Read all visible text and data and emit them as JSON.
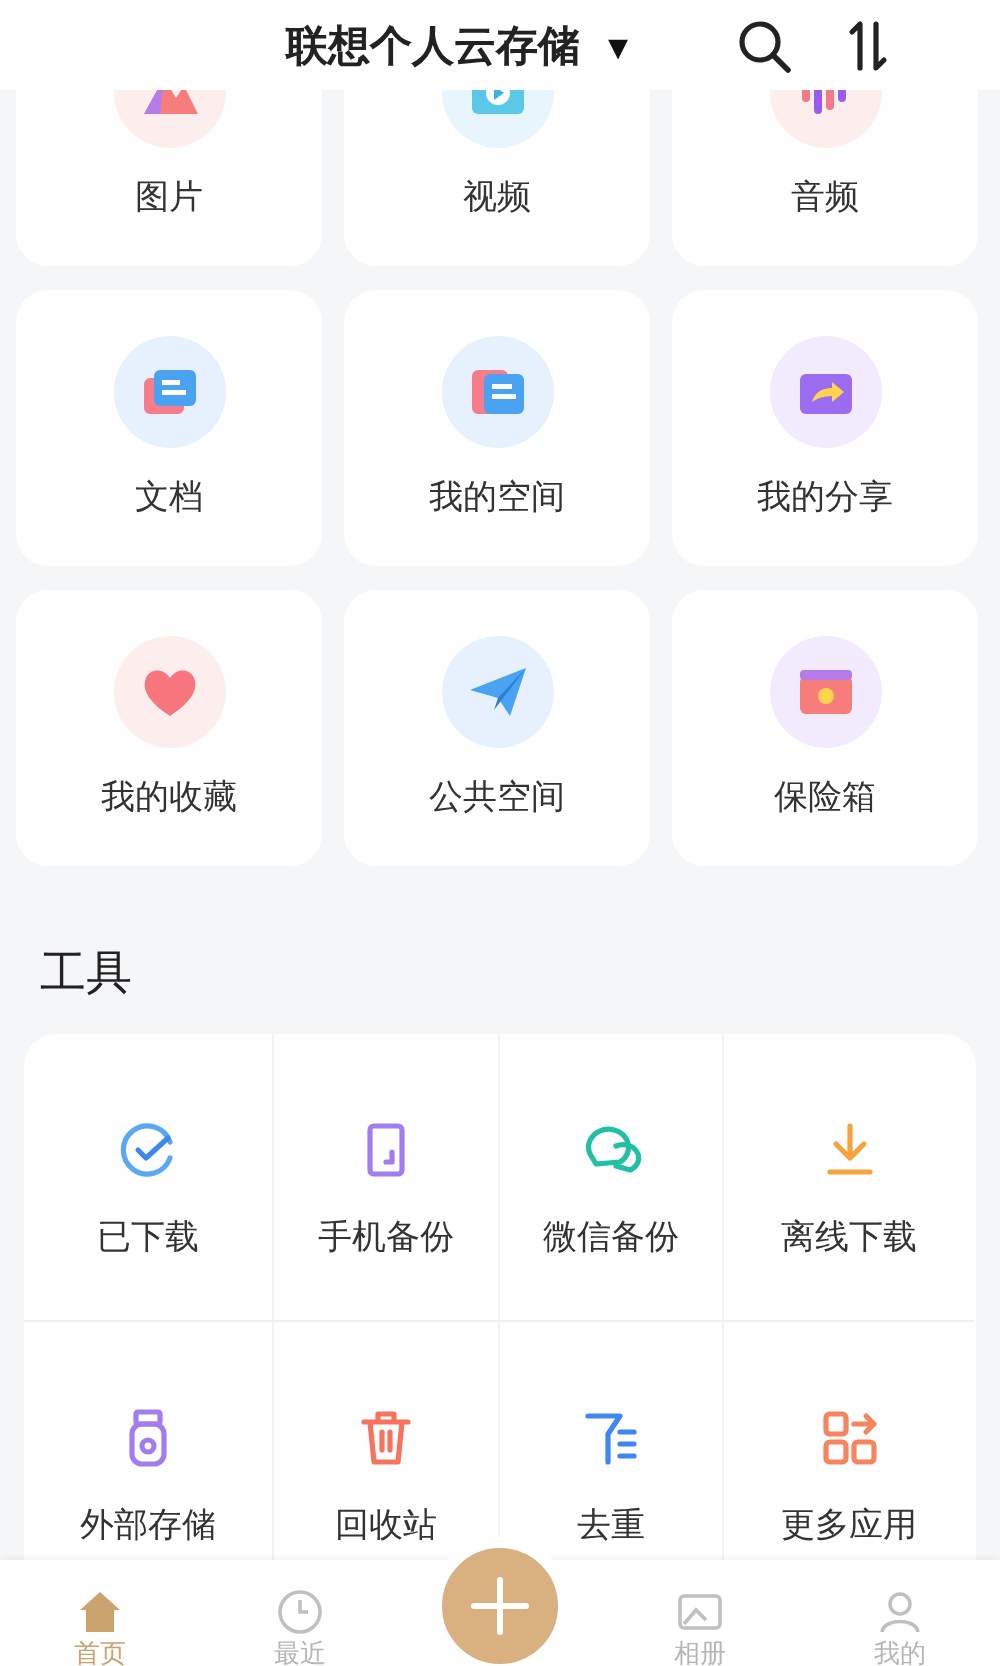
{
  "header": {
    "title": "联想个人云存储",
    "dropdown": "▾"
  },
  "categories": [
    {
      "label": "图片",
      "kind": "photo"
    },
    {
      "label": "视频",
      "kind": "video"
    },
    {
      "label": "音频",
      "kind": "audio"
    },
    {
      "label": "文档",
      "kind": "doc"
    },
    {
      "label": "我的空间",
      "kind": "folder"
    },
    {
      "label": "我的分享",
      "kind": "share"
    },
    {
      "label": "我的收藏",
      "kind": "heart"
    },
    {
      "label": "公共空间",
      "kind": "plane"
    },
    {
      "label": "保险箱",
      "kind": "safe"
    }
  ],
  "tools_title": "工具",
  "tools": [
    {
      "label": "已下载",
      "kind": "check"
    },
    {
      "label": "手机备份",
      "kind": "phone"
    },
    {
      "label": "微信备份",
      "kind": "chat"
    },
    {
      "label": "离线下载",
      "kind": "download"
    },
    {
      "label": "外部存储",
      "kind": "usb"
    },
    {
      "label": "回收站",
      "kind": "trash"
    },
    {
      "label": "去重",
      "kind": "dedupe"
    },
    {
      "label": "更多应用",
      "kind": "apps"
    }
  ],
  "nav": [
    {
      "label": "首页",
      "kind": "home",
      "selected": true
    },
    {
      "label": "最近",
      "kind": "clock",
      "selected": false
    },
    {
      "kind": "add"
    },
    {
      "label": "相册",
      "kind": "album",
      "selected": false
    },
    {
      "label": "我的",
      "kind": "me",
      "selected": false
    }
  ]
}
